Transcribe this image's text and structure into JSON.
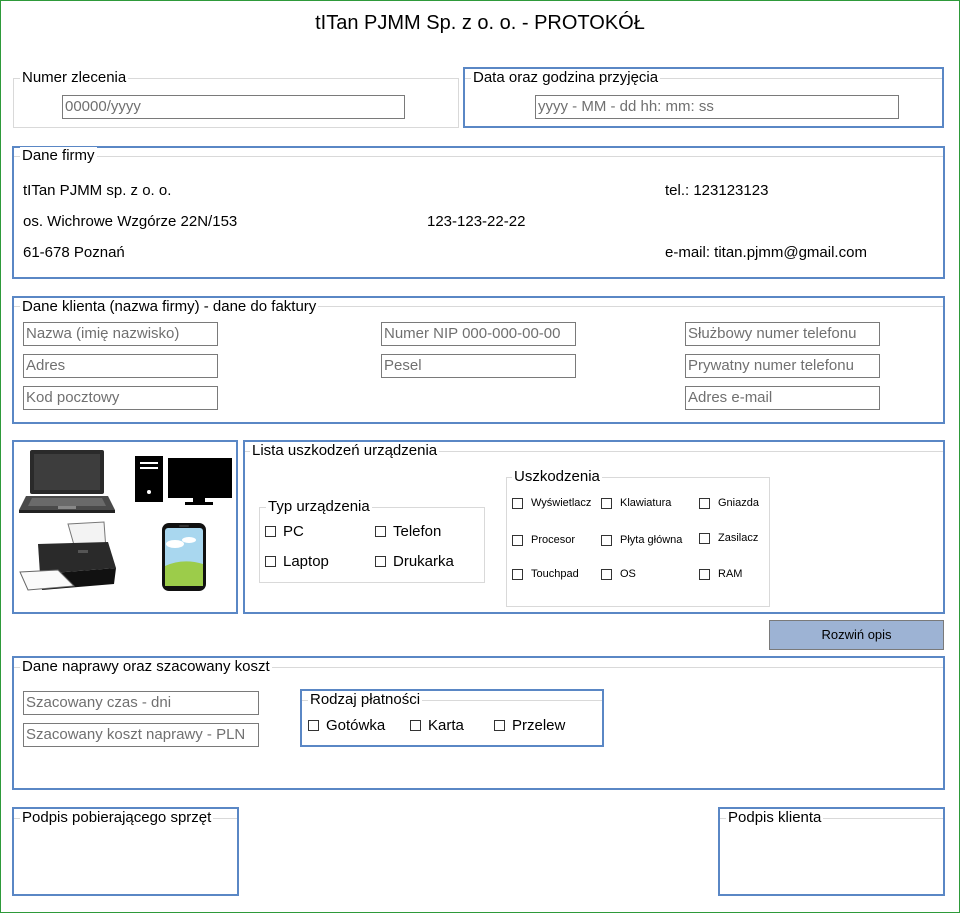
{
  "title": "tITan PJMM Sp. z o. o. - PROTOKÓŁ",
  "order": {
    "legend": "Numer zlecenia",
    "placeholder": "00000/yyyy"
  },
  "received": {
    "legend": "Data oraz godzina przyjęcia",
    "placeholder": "yyyy - MM - dd hh: mm: ss"
  },
  "company": {
    "legend": "Dane firmy",
    "name": "tITan PJMM sp. z o. o.",
    "street": "os. Wichrowe Wzgórze 22N/153",
    "city": "61-678 Poznań",
    "nip": "123-123-22-22",
    "phone": "tel.: 123123123",
    "email": "e-mail: titan.pjmm@gmail.com"
  },
  "client": {
    "legend": "Dane klienta (nazwa firmy) - dane do faktury",
    "name_placeholder": "Nazwa (imię nazwisko)",
    "address_placeholder": "Adres",
    "zip_placeholder": "Kod pocztowy",
    "nip_placeholder": "Numer NIP 000-000-00-00",
    "pesel_placeholder": "Pesel",
    "work_phone_placeholder": "Służbowy numer telefonu",
    "private_phone_placeholder": "Prywatny numer telefonu",
    "email_placeholder": "Adres e-mail"
  },
  "icons": [
    "laptop-icon",
    "desktop-computer-icon",
    "printer-icon",
    "smartphone-icon"
  ],
  "damage": {
    "legend": "Lista uszkodzeń urządzenia",
    "device_type": {
      "legend": "Typ urządzenia",
      "options": [
        "PC",
        "Telefon",
        "Laptop",
        "Drukarka"
      ]
    },
    "faults": {
      "legend": "Uszkodzenia",
      "options": [
        "Wyświetlacz",
        "Klawiatura",
        "Gniazda",
        "Procesor",
        "Płyta główna",
        "Zasilacz",
        "Touchpad",
        "OS",
        "RAM"
      ]
    }
  },
  "expand_button": "Rozwiń opis",
  "repair": {
    "legend": "Dane naprawy oraz szacowany koszt",
    "time_placeholder": "Szacowany czas - dni",
    "cost_placeholder": "Szacowany koszt naprawy - PLN",
    "payment": {
      "legend": "Rodzaj płatności",
      "options": [
        "Gotówka",
        "Karta",
        "Przelew"
      ]
    }
  },
  "signatures": {
    "receiver": "Podpis pobierającego sprzęt",
    "client": "Podpis klienta"
  },
  "colors": {
    "frame": "#2e9a3a",
    "group_border": "#5a87c5",
    "button": "#9db3d4"
  }
}
